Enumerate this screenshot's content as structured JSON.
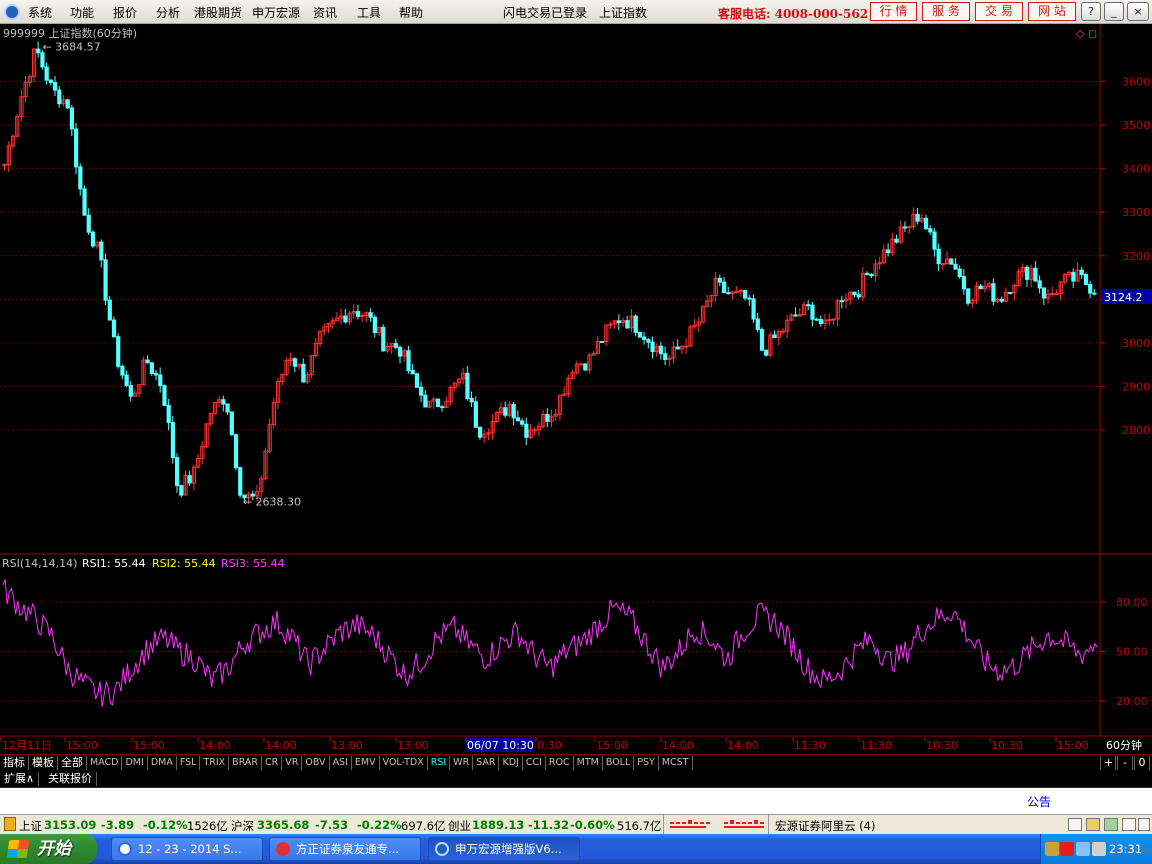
{
  "menu": {
    "items": [
      "系统",
      "功能",
      "报价",
      "分析",
      "港股期货",
      "申万宏源",
      "资讯",
      "工具",
      "帮助"
    ],
    "status1": "闪电交易已登录",
    "status2": "上证指数",
    "hotline": "客服电话: 4008-000-562",
    "right_buttons": [
      "行 情",
      "服 务",
      "交 易",
      "网 站"
    ],
    "window_buttons": [
      "?",
      "_",
      "□",
      "×"
    ]
  },
  "chart_data": [
    {
      "type": "candlestick",
      "title": "999999 上证指数(60分钟)",
      "ylim": [
        2520,
        3700
      ],
      "y_ticks": [
        2800,
        2900,
        3000,
        3100,
        3200,
        3300,
        3400,
        3500,
        3600
      ],
      "current_price": "3124.2",
      "annotations": [
        {
          "label": "3684.57",
          "value": 3684.57
        },
        {
          "label": "2638.30",
          "value": 2638.3
        }
      ],
      "x_labels": [
        "12月11日",
        "15:00",
        "15:00",
        "14:00",
        "14:00",
        "13:00",
        "13:00",
        "06/07 10:30",
        "0:30",
        "15:00",
        "14:00",
        "14:00",
        "11:30",
        "11:30",
        "10:30",
        "10:30",
        "15:00"
      ],
      "period_label": "60分钟",
      "price_path": [
        3410,
        3560,
        3675,
        3580,
        3550,
        3300,
        3200,
        2980,
        2870,
        2960,
        2900,
        2660,
        2700,
        2840,
        2880,
        2650,
        2640,
        2860,
        2980,
        2920,
        3010,
        3050,
        3080,
        3060,
        3000,
        2990,
        2900,
        2850,
        2880,
        2920,
        2800,
        2820,
        2860,
        2800,
        2820,
        2860,
        2950,
        2960,
        3020,
        3060,
        3040,
        3000,
        2960,
        3000,
        3050,
        3130,
        3110,
        3100,
        2980,
        3020,
        3060,
        3080,
        3030,
        3110,
        3120,
        3180,
        3220,
        3260,
        3300,
        3200,
        3190,
        3110,
        3130,
        3100,
        3150,
        3170,
        3100,
        3140,
        3150,
        3124
      ]
    },
    {
      "type": "line",
      "title": "RSI(14,14,14)",
      "series_labels": [
        {
          "label": "RSI1: 55.44",
          "color": "#ffffff"
        },
        {
          "label": "RSI2: 55.44",
          "color": "#ffff00"
        },
        {
          "label": "RSI3: 55.44",
          "color": "#ff40ff"
        }
      ],
      "ylim": [
        0,
        100
      ],
      "y_ticks": [
        "80.00",
        "50.00",
        "20.00"
      ],
      "y_tick_values": [
        80,
        50,
        20
      ],
      "values": [
        88,
        78,
        70,
        60,
        40,
        30,
        24,
        26,
        40,
        52,
        58,
        50,
        45,
        32,
        40,
        55,
        62,
        68,
        58,
        42,
        52,
        62,
        66,
        60,
        48,
        36,
        44,
        58,
        64,
        54,
        46,
        55,
        62,
        48,
        40,
        50,
        56,
        66,
        76,
        70,
        55,
        40,
        50,
        64,
        58,
        45,
        62,
        72,
        68,
        55,
        40,
        32,
        38,
        50,
        58,
        44,
        48,
        62,
        70,
        75,
        60,
        44,
        38,
        42,
        52,
        60,
        55,
        48,
        56
      ]
    }
  ],
  "indicator_tabs": [
    "指标",
    "模板",
    "全部",
    "MACD",
    "DMI",
    "DMA",
    "FSL",
    "TRIX",
    "BRAR",
    "CR",
    "VR",
    "OBV",
    "ASI",
    "EMV",
    "VOL-TDX",
    "RSI",
    "WR",
    "SAR",
    "KDJ",
    "CCI",
    "ROC",
    "MTM",
    "BOLL",
    "PSY",
    "MCST"
  ],
  "selected_tab": "RSI",
  "tab_controls": [
    "+",
    "-",
    "0"
  ],
  "ext_tabs": [
    "扩展∧",
    "关联报价"
  ],
  "notice": "公告",
  "status": {
    "sh_label": "上证",
    "sh_value": "3153.09",
    "sh_change": "-3.89",
    "sh_pct": "-0.12%",
    "sh_amount": "1526亿",
    "hs_label": "沪深",
    "hs_value": "3365.68",
    "hs_change": "-7.53",
    "hs_pct": "-0.22%",
    "hs_amount": "697.6亿",
    "cy_label": "创业",
    "cy_value": "1889.13",
    "cy_change": "-11.32",
    "cy_pct": "-0.60%",
    "cy_amount": "516.7亿",
    "broker": "宏源证券阿里云 (4)"
  },
  "taskbar": {
    "start": "开始",
    "tasks": [
      "12 - 23 - 2014 S...",
      "方正证券泉友通专...",
      "申万宏源增强版V6..."
    ],
    "clock": "23:31"
  }
}
